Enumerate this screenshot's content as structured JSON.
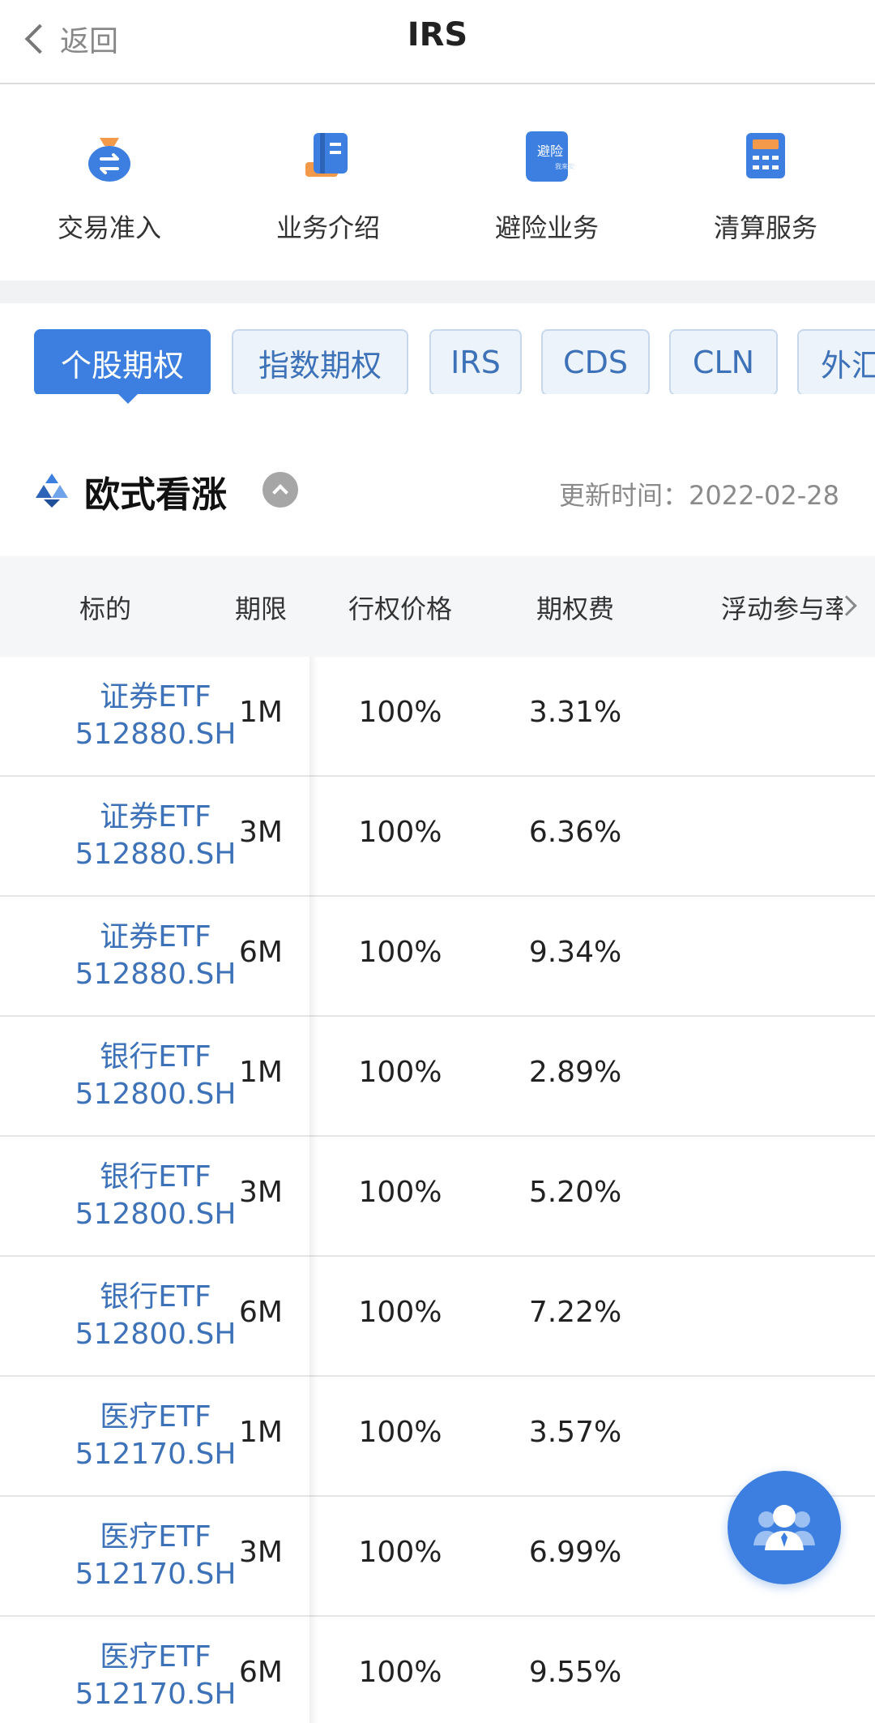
{
  "header": {
    "back_label": "返回",
    "title": "IRS"
  },
  "quick_menu": [
    {
      "label": "交易准入",
      "icon": "money-bag-icon"
    },
    {
      "label": "业务介绍",
      "icon": "document-icon"
    },
    {
      "label": "避险业务",
      "icon": "hedging-badge-icon",
      "icon_text_1": "避险",
      "icon_text_2": "我来安"
    },
    {
      "label": "清算服务",
      "icon": "calculator-icon"
    }
  ],
  "tabs": [
    {
      "label": "个股期权",
      "active": true
    },
    {
      "label": "指数期权"
    },
    {
      "label": "IRS"
    },
    {
      "label": "CDS"
    },
    {
      "label": "CLN"
    },
    {
      "label": "外汇"
    }
  ],
  "section": {
    "title": "欧式看涨",
    "update_label": "更新时间：",
    "update_date": "2022-02-28"
  },
  "table": {
    "columns": [
      "标的",
      "期限",
      "行权价格",
      "期权费",
      "浮动参与率"
    ],
    "rows": [
      {
        "name": "证券ETF",
        "code": "512880.SH",
        "term": "1M",
        "strike": "100%",
        "premium": "3.31%"
      },
      {
        "name": "证券ETF",
        "code": "512880.SH",
        "term": "3M",
        "strike": "100%",
        "premium": "6.36%"
      },
      {
        "name": "证券ETF",
        "code": "512880.SH",
        "term": "6M",
        "strike": "100%",
        "premium": "9.34%"
      },
      {
        "name": "银行ETF",
        "code": "512800.SH",
        "term": "1M",
        "strike": "100%",
        "premium": "2.89%"
      },
      {
        "name": "银行ETF",
        "code": "512800.SH",
        "term": "3M",
        "strike": "100%",
        "premium": "5.20%"
      },
      {
        "name": "银行ETF",
        "code": "512800.SH",
        "term": "6M",
        "strike": "100%",
        "premium": "7.22%"
      },
      {
        "name": "医疗ETF",
        "code": "512170.SH",
        "term": "1M",
        "strike": "100%",
        "premium": "3.57%"
      },
      {
        "name": "医疗ETF",
        "code": "512170.SH",
        "term": "3M",
        "strike": "100%",
        "premium": "6.99%"
      },
      {
        "name": "医疗ETF",
        "code": "512170.SH",
        "term": "6M",
        "strike": "100%",
        "premium": "9.55%"
      }
    ]
  },
  "colors": {
    "accent": "#3c7fe0",
    "link": "#3d72b8",
    "tab_bg": "#edf3fb",
    "orange": "#f39a4a"
  },
  "fab": {
    "icon": "customer-service-icon"
  }
}
